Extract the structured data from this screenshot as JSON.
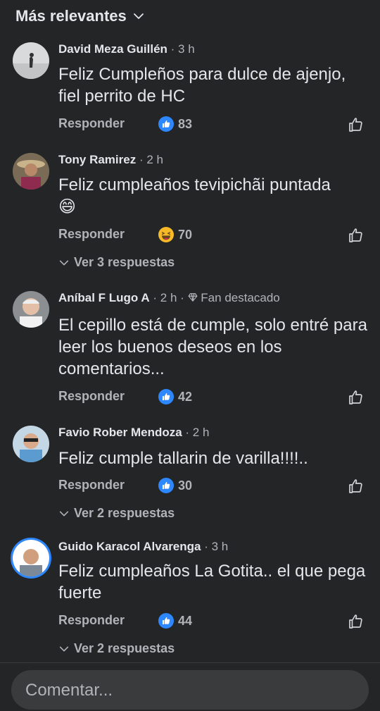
{
  "header": {
    "sort_label": "Más relevantes"
  },
  "comments": [
    {
      "author": "David Meza Guillén",
      "time": "· 3 h",
      "text": "Feliz Cumpleños para dulce de ajenjo, fiel perrito de HC",
      "reply_label": "Responder",
      "reaction_icon": "like-icon",
      "reaction_count": "83"
    },
    {
      "author": "Tony Ramirez",
      "time": "· 2 h",
      "text": "Feliz cumpleaños tevipichãi puntada",
      "emoji": "😄",
      "reply_label": "Responder",
      "reaction_icon": "haha-icon",
      "reaction_count": "70",
      "replies_label": "Ver 3 respuestas"
    },
    {
      "author": "Aníbal F Lugo A",
      "time": "· 2 h ·",
      "badge": "Fan destacado",
      "text": "El cepillo está de cumple, solo entré para leer los buenos deseos en los comentarios...",
      "reply_label": "Responder",
      "reaction_icon": "like-icon",
      "reaction_count": "42"
    },
    {
      "author": "Favio Rober Mendoza",
      "time": "· 2 h",
      "text": "Feliz cumple tallarin de varilla!!!!..",
      "reply_label": "Responder",
      "reaction_icon": "like-icon",
      "reaction_count": "30",
      "replies_label": "Ver 2 respuestas"
    },
    {
      "author": "Guido Karacol Alvarenga",
      "time": "· 3 h",
      "text": "Feliz cumpleaños La Gotita.. el que pega fuerte",
      "reply_label": "Responder",
      "reaction_icon": "like-icon",
      "reaction_count": "44",
      "replies_label": "Ver 2 respuestas"
    }
  ],
  "footer": {
    "placeholder": "Comentar..."
  },
  "colors": {
    "background": "#242526",
    "like_blue": "#2d88ff",
    "secondary_text": "#b0b3b8",
    "input_bg": "#3a3b3c"
  }
}
